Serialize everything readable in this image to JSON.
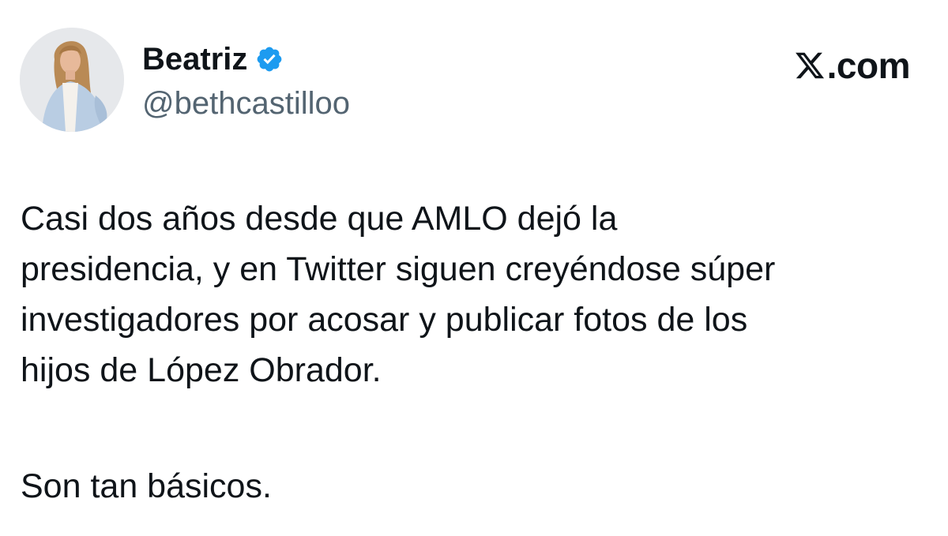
{
  "author": {
    "name": "Beatriz",
    "handle": "@bethcastilloo",
    "verified": true,
    "verified_icon": "verified-badge-icon",
    "verified_color": "#1d9bf0"
  },
  "brand": {
    "logo_icon": "x-logo-icon",
    "domain": ".com"
  },
  "tweet": {
    "lines": [
      "Casi dos años desde que AMLO dejó la",
      "presidencia, y en Twitter siguen creyéndose súper",
      "investigadores por acosar y publicar fotos de los",
      "hijos de López Obrador."
    ],
    "closing": "Son tan básicos."
  },
  "colors": {
    "text_primary": "#0f1419",
    "text_secondary": "#536471",
    "background": "#ffffff"
  }
}
